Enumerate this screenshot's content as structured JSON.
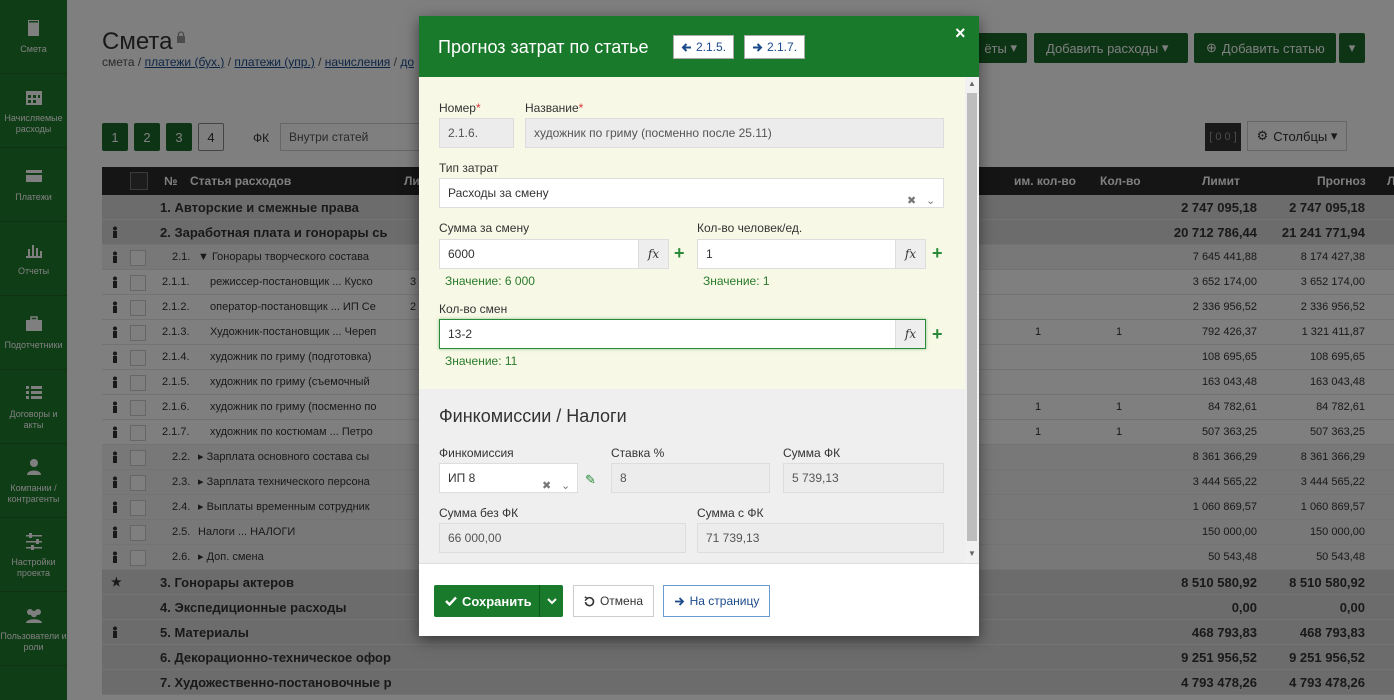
{
  "sidebar": {
    "items": [
      {
        "label": "Смета",
        "icon": "book-icon"
      },
      {
        "label": "Начисляемые расходы",
        "icon": "calendar-icon"
      },
      {
        "label": "Платежи",
        "icon": "card-icon"
      },
      {
        "label": "Отчеты",
        "icon": "chart-icon"
      },
      {
        "label": "Подотчетники",
        "icon": "briefcase-icon"
      },
      {
        "label": "Договоры и акты",
        "icon": "list-icon"
      },
      {
        "label": "Компании / контрагенты",
        "icon": "user-icon"
      },
      {
        "label": "Настройки проекта",
        "icon": "sliders-icon"
      },
      {
        "label": "Пользователи и роли",
        "icon": "users-icon"
      }
    ]
  },
  "page": {
    "title": "Смета",
    "breadcrumb": [
      {
        "text": "смета",
        "link": false
      },
      {
        "text": "платежи (бух.)",
        "link": true
      },
      {
        "text": "платежи (упр.)",
        "link": true
      },
      {
        "text": "начисления",
        "link": true
      },
      {
        "text": "до",
        "link": true
      }
    ],
    "breadcrumb_sep": " / ",
    "toolbar": {
      "reports_fragment": "ёты",
      "add_expenses": "Добавить расходы",
      "add_article": "Добавить статью"
    },
    "levels": [
      "1",
      "2",
      "3",
      "4"
    ],
    "fk_label": "ФК",
    "fk_select": "Внутри статей",
    "counter": "[ 0 0 ]",
    "columns_btn": "Столбцы"
  },
  "table": {
    "headers": {
      "no": "№",
      "article": "Статья расходов",
      "li": "Ли",
      "plan_qty": "им. кол-во",
      "qty": "Кол-во",
      "limit": "Лимит",
      "forecast": "Прогноз",
      "extra": "Ли"
    },
    "rows": [
      {
        "level": 1,
        "no": "",
        "name": "1. Авторские и смежные права",
        "limit": "2 747 095,18",
        "forecast": "2 747 095,18",
        "pin": false
      },
      {
        "level": 1,
        "no": "",
        "name": "2. Заработная плата и гонорары сь",
        "limit": "20 712 786,44",
        "forecast": "21 241 771,94",
        "pin": true
      },
      {
        "level": 2,
        "no": "2.1.",
        "name": "▼ Гонорары творческого состава",
        "limit": "7 645 441,88",
        "forecast": "8 174 427,38",
        "pin": true
      },
      {
        "level": 3,
        "no": "2.1.1.",
        "name": "режиссер-постановщик ... Куско",
        "li": "3",
        "limit": "3 652 174,00",
        "forecast": "3 652 174,00",
        "pin": true
      },
      {
        "level": 3,
        "no": "2.1.2.",
        "name": "оператор-постановщик ... ИП Се",
        "li": "2",
        "limit": "2 336 956,52",
        "forecast": "2 336 956,52",
        "pin": true
      },
      {
        "level": 3,
        "no": "2.1.3.",
        "name": "Художник-постановщик ... Череп",
        "plan_qty": "1",
        "qty": "1",
        "limit": "792 426,37",
        "forecast": "1 321 411,87",
        "pin": true
      },
      {
        "level": 3,
        "no": "2.1.4.",
        "name": "художник по гриму (подготовка)",
        "limit": "108 695,65",
        "forecast": "108 695,65",
        "pin": true
      },
      {
        "level": 3,
        "no": "2.1.5.",
        "name": "художник по гриму (съемочный",
        "limit": "163 043,48",
        "forecast": "163 043,48",
        "pin": true
      },
      {
        "level": 3,
        "no": "2.1.6.",
        "name": "художник по гриму (посменно по",
        "plan_qty": "1",
        "qty": "1",
        "limit": "84 782,61",
        "forecast": "84 782,61",
        "pin": true
      },
      {
        "level": 3,
        "no": "2.1.7.",
        "name": "художник по костюмам ... Петро",
        "plan_qty": "1",
        "qty": "1",
        "limit": "507 363,25",
        "forecast": "507 363,25",
        "pin": true
      },
      {
        "level": 2,
        "no": "2.2.",
        "name": "▸ Зарплата основного состава сы",
        "limit": "8 361 366,29",
        "forecast": "8 361 366,29",
        "pin": true
      },
      {
        "level": 2,
        "no": "2.3.",
        "name": "▸ Зарплата технического персона",
        "limit": "3 444 565,22",
        "forecast": "3 444 565,22",
        "pin": true
      },
      {
        "level": 2,
        "no": "2.4.",
        "name": "▸ Выплаты временным сотрудник",
        "limit": "1 060 869,57",
        "forecast": "1 060 869,57",
        "pin": true
      },
      {
        "level": 2,
        "no": "2.5.",
        "name": "Налоги ... НАЛОГИ",
        "limit": "150 000,00",
        "forecast": "150 000,00",
        "pin": true
      },
      {
        "level": 2,
        "no": "2.6.",
        "name": "▸ Доп. смена",
        "limit": "50 543,48",
        "forecast": "50 543,48",
        "pin": true
      },
      {
        "level": 1,
        "no": "",
        "name": "3. Гонорары актеров",
        "limit": "8 510 580,92",
        "forecast": "8 510 580,92",
        "star": true
      },
      {
        "level": 1,
        "no": "",
        "name": "4. Экспедиционные расходы",
        "limit": "0,00",
        "forecast": "0,00",
        "pin": false
      },
      {
        "level": 1,
        "no": "",
        "name": "5. Материалы",
        "limit": "468 793,83",
        "forecast": "468 793,83",
        "pin": true
      },
      {
        "level": 1,
        "no": "",
        "name": "6. Декорационно-техническое офор",
        "limit": "9 251 956,52",
        "forecast": "9 251 956,52",
        "pin": false
      },
      {
        "level": 1,
        "no": "",
        "name": "7. Художественно-постановочные р",
        "limit": "4 793 478,26",
        "forecast": "4 793 478,26",
        "pin": false
      }
    ]
  },
  "modal": {
    "title": "Прогноз затрат по статье",
    "prev": "2.1.5.",
    "next": "2.1.7.",
    "close": "×",
    "number_label": "Номер",
    "number_value": "2.1.6.",
    "name_label": "Название",
    "name_value": "художник по гриму (посменно после 25.11)",
    "required_mark": "*",
    "cost_type_label": "Тип затрат",
    "cost_type_value": "Расходы за смену",
    "shift_sum_label": "Сумма за смену",
    "shift_sum_value": "6000",
    "shift_sum_result": "Значение: 6 000",
    "people_label": "Кол-во человек/ед.",
    "people_value": "1",
    "people_result": "Значение: 1",
    "shifts_label": "Кол-во смен",
    "shifts_value": "13-2",
    "shifts_result": "Значение: 11",
    "fx": "fx",
    "fin_title": "Финкомиссии / Налоги",
    "fin_label": "Финкомиссия",
    "fin_value": "ИП 8",
    "rate_label": "Ставка %",
    "rate_value": "8",
    "fk_sum_label": "Сумма ФК",
    "fk_sum_value": "5 739,13",
    "sum_wo_label": "Сумма без ФК",
    "sum_wo_value": "66 000,00",
    "sum_with_label": "Сумма с ФК",
    "sum_with_value": "71 739,13",
    "save": "Сохранить",
    "cancel": "Отмена",
    "to_page": "На страницу"
  },
  "colors": {
    "sidebar": "#1f7a2c",
    "header_green": "#1a7a2b",
    "value_green": "#2a7a2a",
    "section_bg": "#f7f9e6"
  }
}
